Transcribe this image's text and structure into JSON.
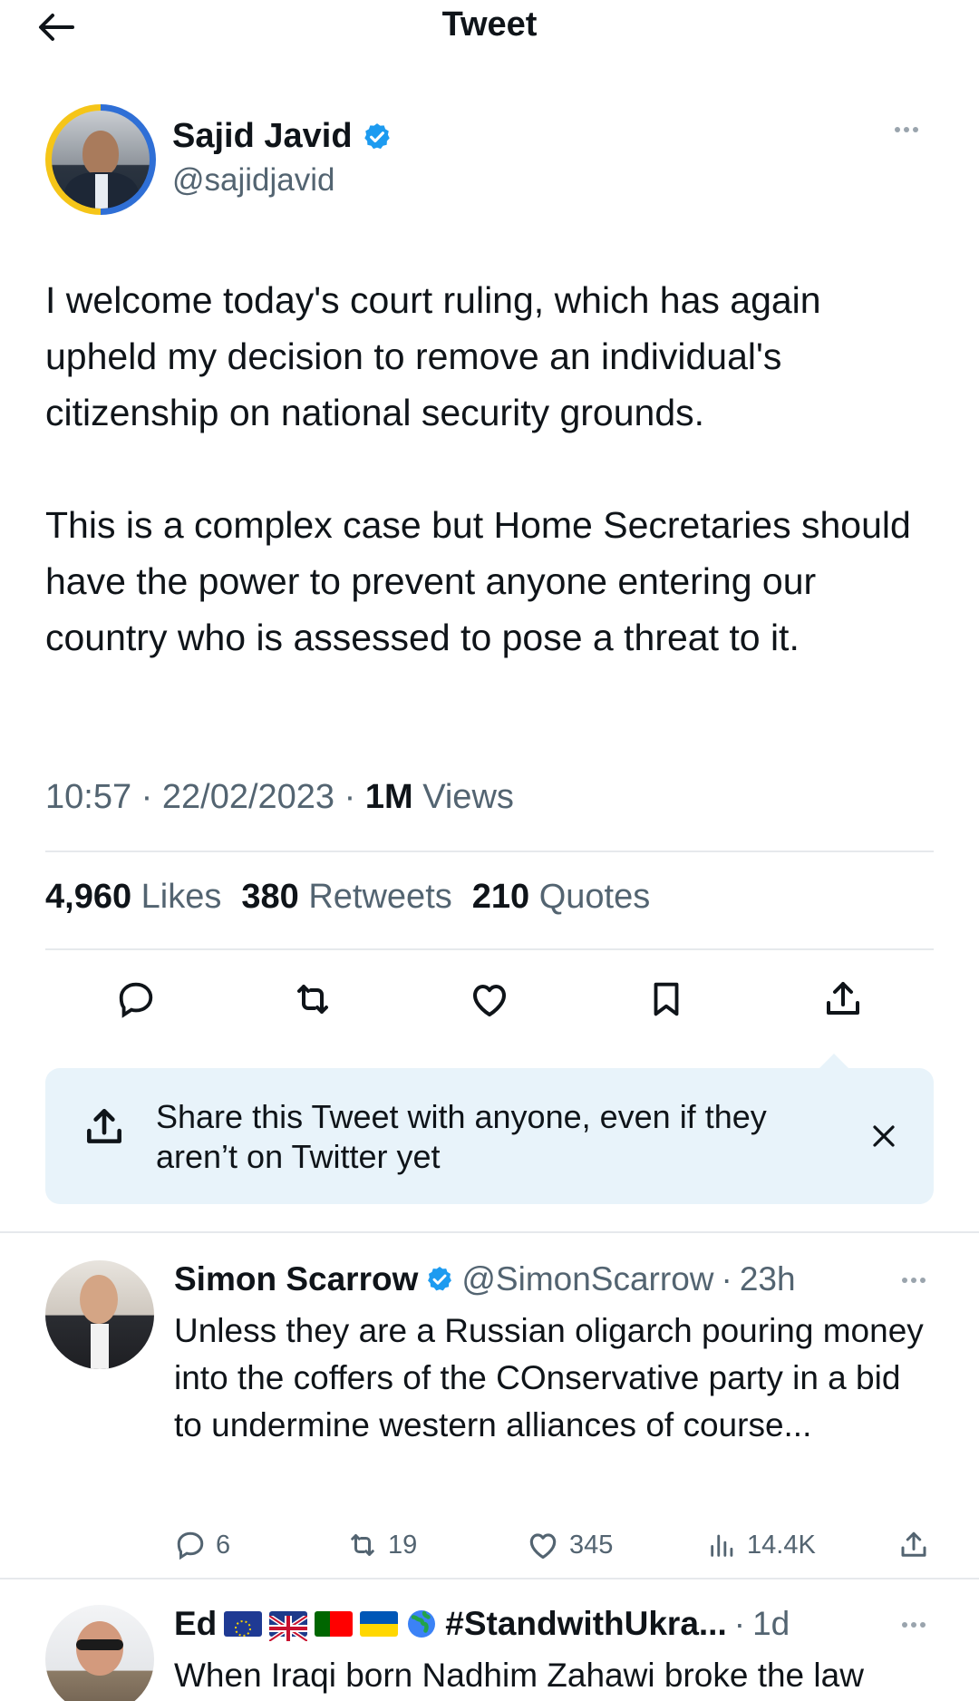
{
  "header": {
    "title": "Tweet",
    "back_icon": "arrow-left-icon"
  },
  "tweet": {
    "author": {
      "name": "Sajid Javid",
      "handle": "@sajidjavid",
      "verified": true
    },
    "text": "I welcome today's court ruling, which has again upheld my decision to remove an individual's citizenship on national security grounds.\n\nThis is a complex case but Home Secretaries should have the power to prevent anyone entering our country who is assessed to pose a threat to it.",
    "time": "10:57",
    "date": "22/02/2023",
    "views_count": "1M",
    "views_label": "Views",
    "stats": {
      "likes_count": "4,960",
      "likes_label": "Likes",
      "retweets_count": "380",
      "retweets_label": "Retweets",
      "quotes_count": "210",
      "quotes_label": "Quotes"
    }
  },
  "share_banner": {
    "text": "Share this Tweet with anyone, even if they aren’t on Twitter yet"
  },
  "replies": [
    {
      "name": "Simon Scarrow",
      "handle": "@SimonScarrow",
      "time": "23h",
      "verified": true,
      "text": "Unless they are a Russian oligarch pouring money into the coffers of the COnservative party in a bid to undermine western alliances of course...",
      "replies_count": "6",
      "retweets_count": "19",
      "likes_count": "345",
      "views_count": "14.4K"
    },
    {
      "name": "Ed",
      "name_suffix": "#StandwithUkra...",
      "time": "1d",
      "text": "When Iraqi born Nadhim Zahawi broke the law"
    }
  ],
  "colors": {
    "accent": "#1d9bf0",
    "muted": "#536471",
    "text": "#0f1419",
    "banner_bg": "#e8f3fa"
  }
}
